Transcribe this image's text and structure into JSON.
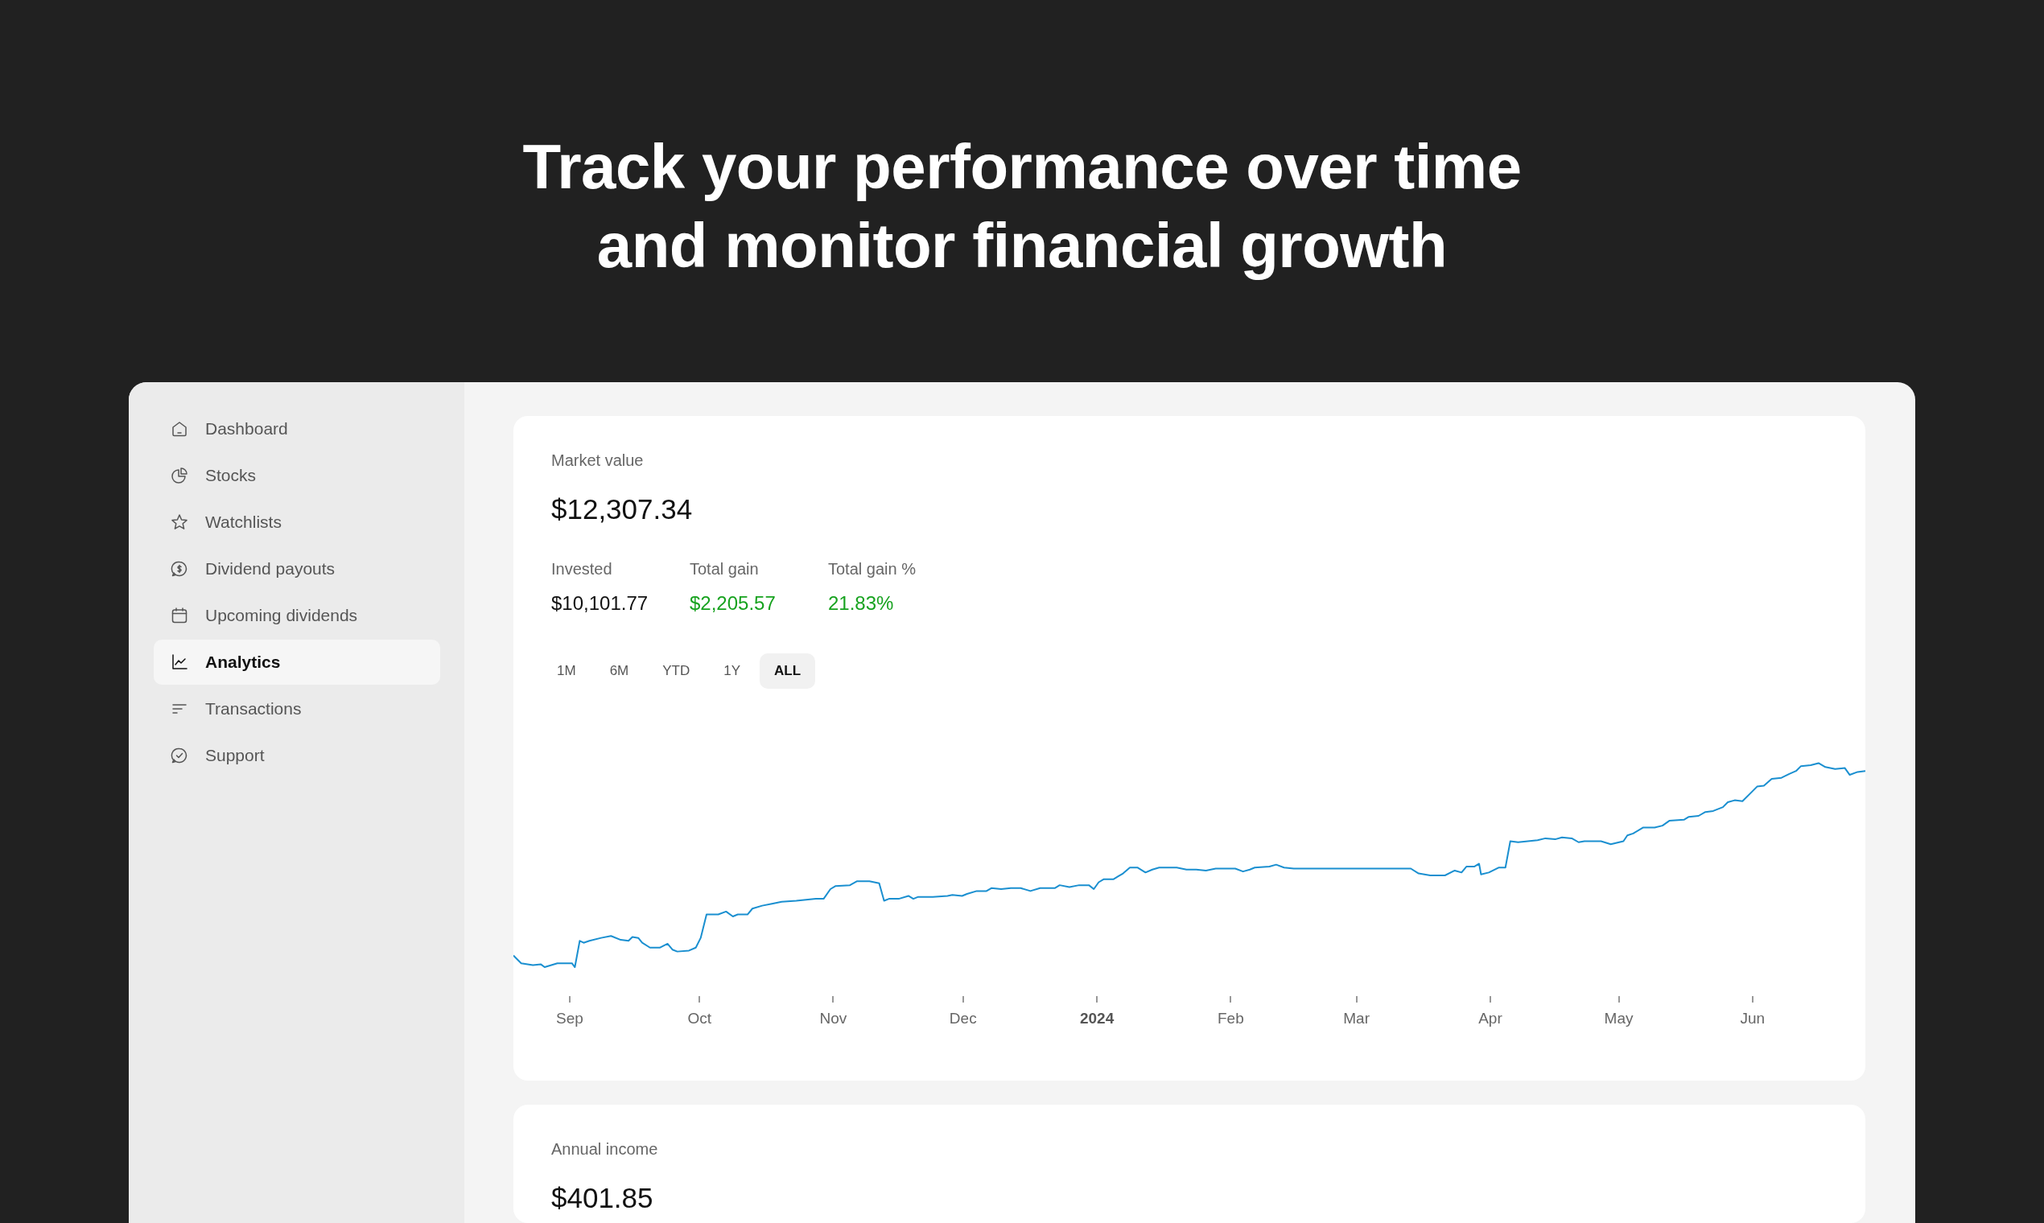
{
  "headline": "Track your performance over time\nand monitor financial growth",
  "sidebar": {
    "items": [
      {
        "label": "Dashboard",
        "selected": false
      },
      {
        "label": "Stocks",
        "selected": false
      },
      {
        "label": "Watchlists",
        "selected": false
      },
      {
        "label": "Dividend payouts",
        "selected": false
      },
      {
        "label": "Upcoming dividends",
        "selected": false
      },
      {
        "label": "Analytics",
        "selected": true
      },
      {
        "label": "Transactions",
        "selected": false
      },
      {
        "label": "Support",
        "selected": false
      }
    ]
  },
  "market_card": {
    "title": "Market value",
    "value": "$12,307.34",
    "stats": [
      {
        "label": "Invested",
        "value": "$10,101.77",
        "positive": false
      },
      {
        "label": "Total gain",
        "value": "$2,205.57",
        "positive": true
      },
      {
        "label": "Total gain %",
        "value": "21.83%",
        "positive": true
      }
    ],
    "ranges": [
      {
        "label": "1M",
        "selected": false
      },
      {
        "label": "6M",
        "selected": false
      },
      {
        "label": "YTD",
        "selected": false
      },
      {
        "label": "1Y",
        "selected": false
      },
      {
        "label": "ALL",
        "selected": true
      }
    ],
    "x_axis_labels": [
      {
        "label": "Sep",
        "kind": "month"
      },
      {
        "label": "Oct",
        "kind": "month"
      },
      {
        "label": "Nov",
        "kind": "month"
      },
      {
        "label": "Dec",
        "kind": "month"
      },
      {
        "label": "2024",
        "kind": "year"
      },
      {
        "label": "Feb",
        "kind": "month"
      },
      {
        "label": "Mar",
        "kind": "month"
      },
      {
        "label": "Apr",
        "kind": "month"
      },
      {
        "label": "May",
        "kind": "month"
      },
      {
        "label": "Jun",
        "kind": "month"
      }
    ]
  },
  "income_card": {
    "title": "Annual income",
    "value": "$401.85"
  }
}
